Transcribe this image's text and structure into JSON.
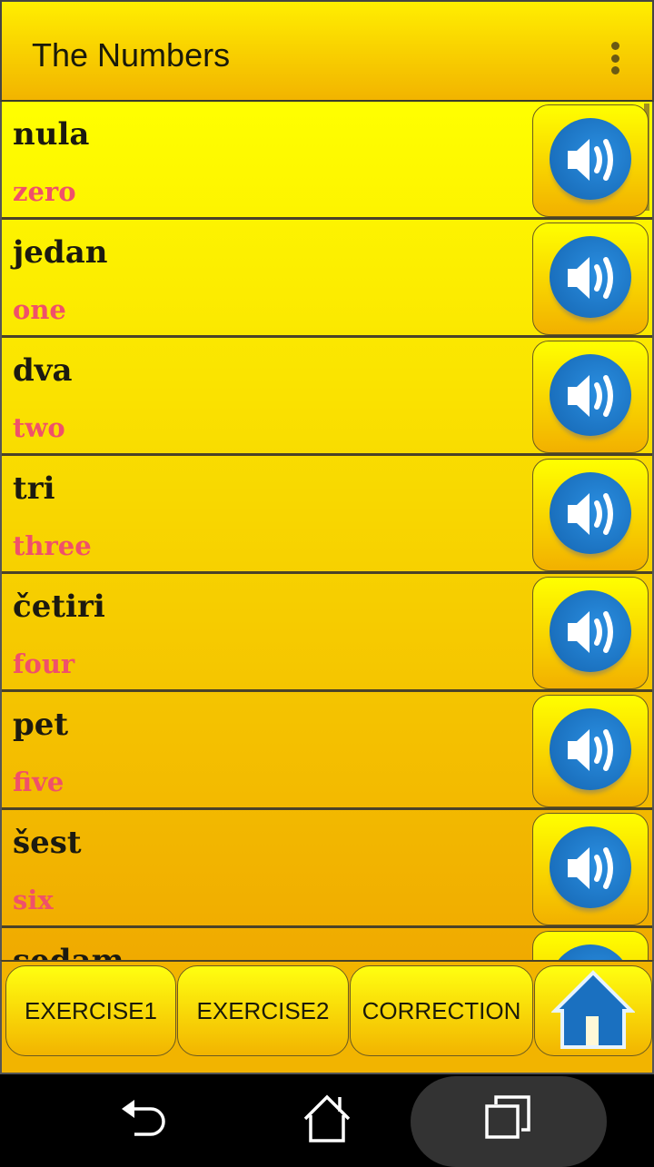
{
  "appbar": {
    "title": "The Numbers",
    "menu_icon": "overflow-menu-icon"
  },
  "items": [
    {
      "word": "nula",
      "translation": "zero"
    },
    {
      "word": "jedan",
      "translation": "one"
    },
    {
      "word": "dva",
      "translation": "two"
    },
    {
      "word": "tri",
      "translation": "three"
    },
    {
      "word": "četiri",
      "translation": "four"
    },
    {
      "word": "pet",
      "translation": "five"
    },
    {
      "word": "šest",
      "translation": "six"
    },
    {
      "word": "sedam",
      "translation": ""
    }
  ],
  "bottom": {
    "exercise1": "EXERCISE1",
    "exercise2": "EXERCISE2",
    "correction": "CORRECTION",
    "home_icon": "home-icon"
  },
  "colors": {
    "word": "#1c1a10",
    "translation": "#f0506a",
    "speaker": "#1a78c8",
    "background_top": "#ffff00",
    "background_bottom": "#f0aa00"
  }
}
